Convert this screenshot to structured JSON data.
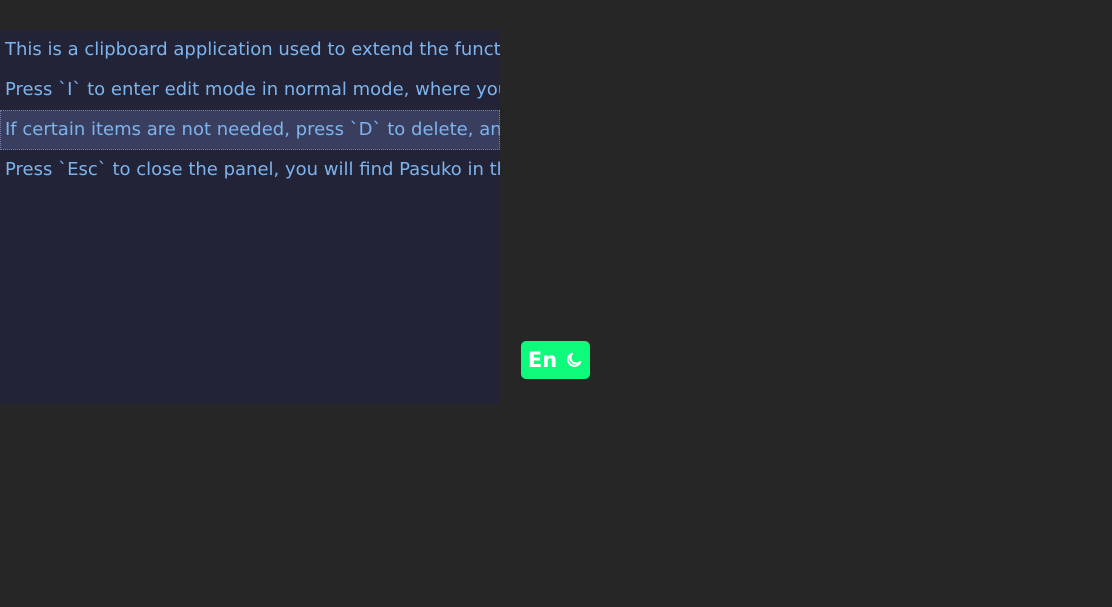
{
  "clipboard": {
    "items": [
      {
        "text": "This is a clipboard application used to extend the function"
      },
      {
        "text": "Press `I` to enter edit mode in normal mode, where you ca"
      },
      {
        "text": "If certain items are not needed, press `D` to delete, and wh"
      },
      {
        "text": "Press `Esc` to close the panel, you will find Pasuko in the t"
      }
    ],
    "selected_index": 2
  },
  "toggle": {
    "language_label": "En",
    "theme_icon": "moon-icon",
    "background_color": "#0dfa7a"
  },
  "colors": {
    "page_background": "#262626",
    "panel_background": "#222336",
    "item_text": "#7cb4ee",
    "selected_background": "#3a3e5e"
  }
}
